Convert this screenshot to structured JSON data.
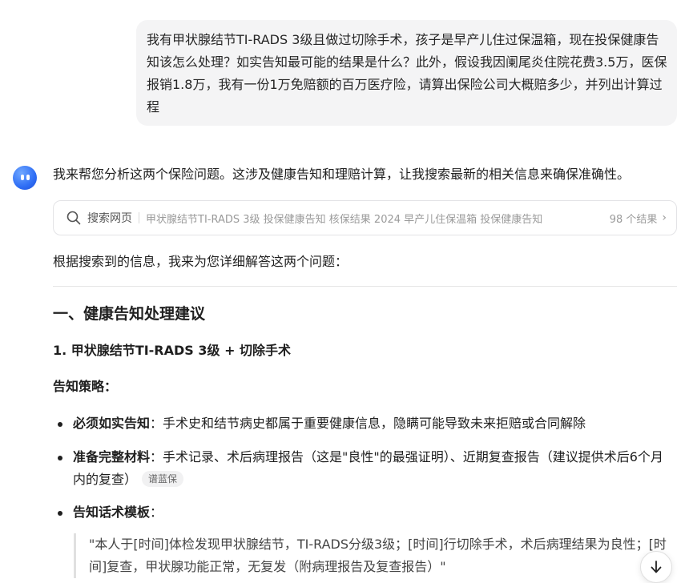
{
  "user_message": {
    "text": "我有甲状腺结节TI-RADS 3级且做过切除手术，孩子是早产儿住过保温箱，现在投保健康告知该怎么处理？如实告知最可能的结果是什么？此外，假设我因阑尾炎住院花费3.5万，医保报销1.8万，我有一份1万免赔额的百万医疗险，请算出保险公司大概赔多少，并列出计算过程"
  },
  "assistant": {
    "avatar_icon": "assistant-avatar-icon",
    "intro": "我来帮您分析这两个保险问题。这涉及健康告知和理赔计算，让我搜索最新的相关信息来确保准确性。",
    "search": {
      "label": "搜索网页",
      "query": "甲状腺结节TI-RADS 3级 投保健康告知 核保结果 2024 早产儿住保温箱 投保健康告知",
      "count": "98 个结果"
    },
    "lead": "根据搜索到的信息，我来为您详细解答这两个问题：",
    "section_title": "一、健康告知处理建议",
    "subsection_title": "1. 甲状腺结节TI-RADS 3级 + 切除手术",
    "strategy_label": "告知策略：",
    "bullets": [
      {
        "title": "必须如实告知",
        "text": "：手术史和结节病史都属于重要健康信息，隐瞒可能导致未来拒赔或合同解除",
        "tag": ""
      },
      {
        "title": "准备完整材料",
        "text": "：手术记录、术后病理报告（这是\"良性\"的最强证明）、近期复查报告（建议提供术后6个月内的复查）",
        "tag": "谱蓝保"
      },
      {
        "title": "告知话术模板",
        "text": "：",
        "tag": ""
      }
    ],
    "quote": "\"本人于[时间]体检发现甲状腺结节，TI-RADS分级3级；[时间]行切除手术，术后病理结果为良性；[时间]复查，甲状腺功能正常，无复发（附病理报告及复查报告）\""
  },
  "icons": {
    "search": "search-icon",
    "chevron": "chevron-right-icon",
    "scroll": "arrow-down-icon"
  }
}
